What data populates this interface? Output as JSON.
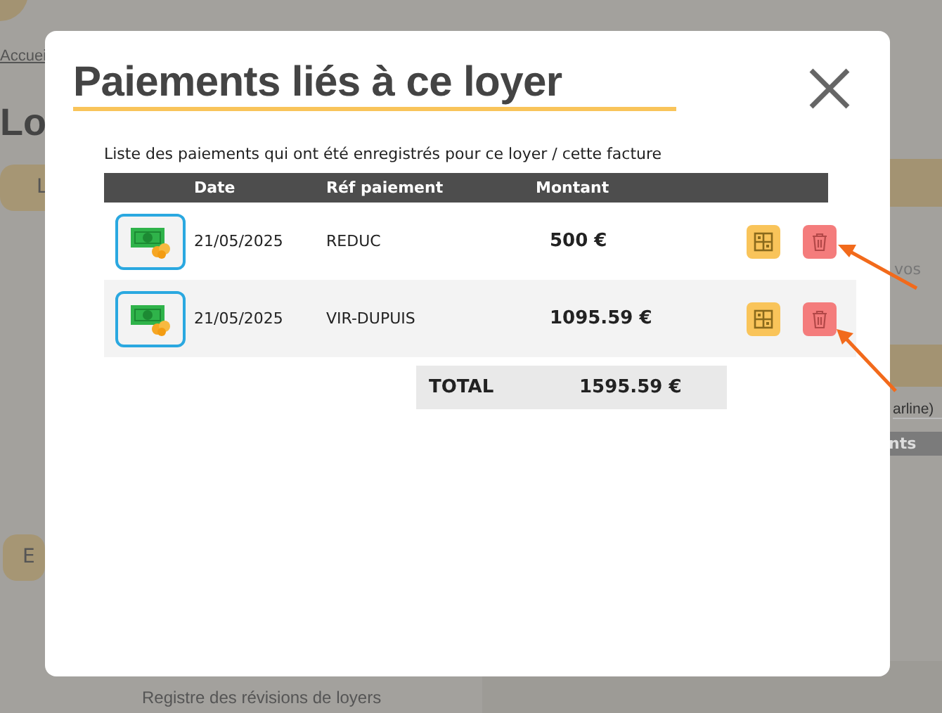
{
  "background": {
    "breadcrumb": "Accuei",
    "heading": "Lo",
    "top_button": "L",
    "side_text": "vos",
    "row_text": "arline)",
    "bar_text": "nts",
    "left_button": "E",
    "menu_items": [
      "Registre des révisions de loyers"
    ]
  },
  "modal": {
    "title": "Paiements liés à ce loyer",
    "description": "Liste des paiements qui ont été enregistrés pour ce loyer / cette facture",
    "columns": [
      "Date",
      "Réf paiement",
      "Montant"
    ],
    "payments": [
      {
        "date": "21/05/2025",
        "reference": "REDUC",
        "amount": "500 €"
      },
      {
        "date": "21/05/2025",
        "reference": "VIR-DUPUIS",
        "amount": "1095.59 €"
      }
    ],
    "total": {
      "label": "TOTAL",
      "value": "1595.59 €"
    }
  }
}
